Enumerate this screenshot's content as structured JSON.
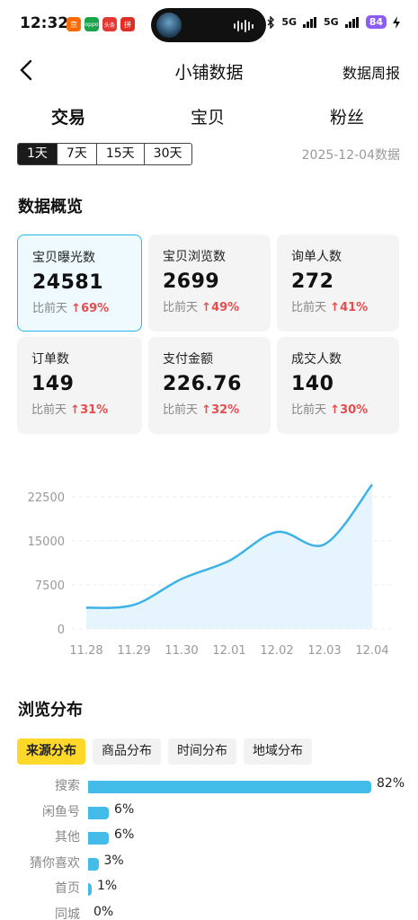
{
  "status": {
    "time": "12:32",
    "battery": "84",
    "net": "5G",
    "apps": [
      {
        "label": "京",
        "color": "#ff6a00"
      },
      {
        "label": "oppo",
        "color": "#1aa34a"
      },
      {
        "label": "头条",
        "color": "#e53935"
      },
      {
        "label": "拼",
        "color": "#e02e24"
      }
    ]
  },
  "header": {
    "title": "小铺数据",
    "right_link": "数据周报"
  },
  "tabs": [
    "交易",
    "宝贝",
    "粉丝"
  ],
  "range": {
    "options": [
      "1天",
      "7天",
      "15天",
      "30天"
    ],
    "selected": "1天"
  },
  "date_label": "2025-12-04数据",
  "overview": {
    "title": "数据概览",
    "compare_prefix": "比前天",
    "cards": [
      {
        "label": "宝贝曝光数",
        "value": "24581",
        "change": "69%"
      },
      {
        "label": "宝贝浏览数",
        "value": "2699",
        "change": "49%"
      },
      {
        "label": "询单人数",
        "value": "272",
        "change": "41%"
      },
      {
        "label": "订单数",
        "value": "149",
        "change": "31%"
      },
      {
        "label": "支付金额",
        "value": "226.76",
        "change": "32%"
      },
      {
        "label": "成交人数",
        "value": "140",
        "change": "30%"
      }
    ]
  },
  "chart_data": {
    "type": "area",
    "x": [
      "11.28",
      "11.29",
      "11.30",
      "12.01",
      "12.02",
      "12.03",
      "12.04"
    ],
    "series": [
      {
        "values": [
          3600,
          4100,
          8500,
          11600,
          16500,
          14400,
          24581
        ]
      }
    ],
    "y_ticks": [
      "0",
      "7500",
      "15000",
      "22500"
    ],
    "ylim": [
      0,
      26000
    ],
    "grid": true,
    "line_color": "#3cb2e6",
    "fill_color": "#e6f5fd"
  },
  "distribution": {
    "title": "浏览分布",
    "tabs": [
      "来源分布",
      "商品分布",
      "时间分布",
      "地域分布"
    ],
    "selected": "来源分布",
    "rows": [
      {
        "label": "搜索",
        "percent": 82,
        "text": "82%"
      },
      {
        "label": "闲鱼号",
        "percent": 6,
        "text": "6%"
      },
      {
        "label": "其他",
        "percent": 6,
        "text": "6%"
      },
      {
        "label": "猜你喜欢",
        "percent": 3,
        "text": "3%"
      },
      {
        "label": "首页",
        "percent": 1,
        "text": "1%"
      },
      {
        "label": "同城",
        "percent": 0,
        "text": "0%"
      }
    ]
  }
}
